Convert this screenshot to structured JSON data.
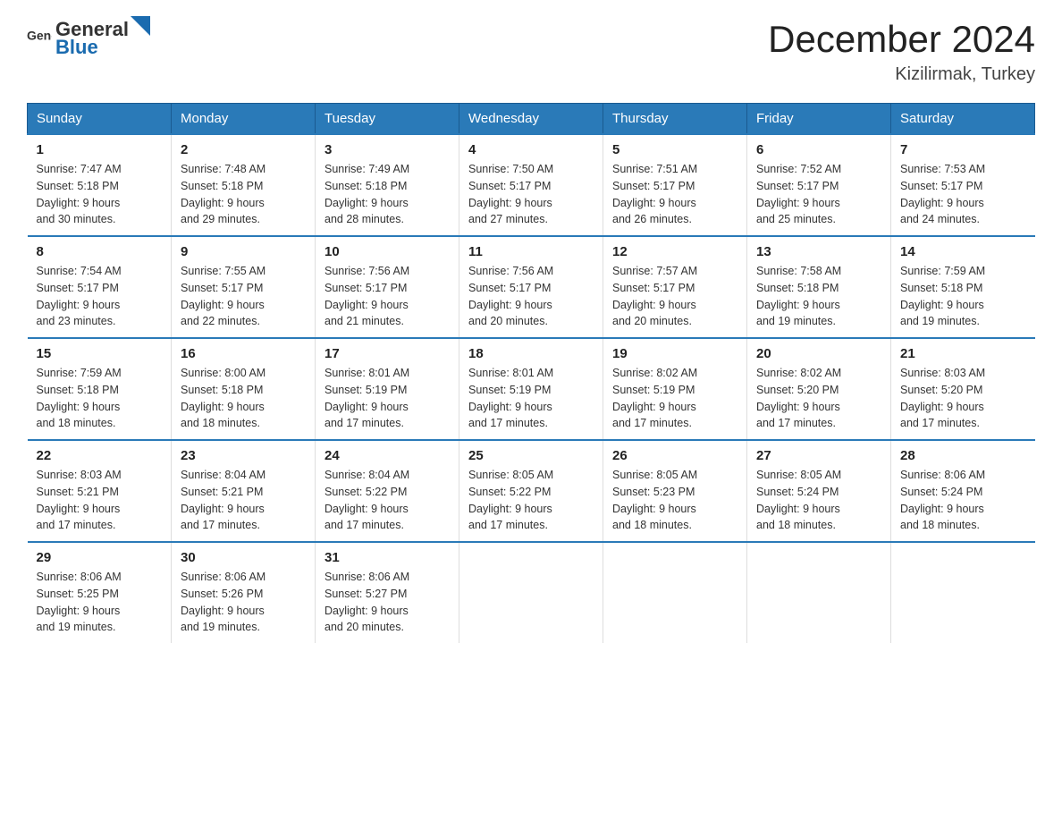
{
  "header": {
    "logo_general": "General",
    "logo_blue": "Blue",
    "month_title": "December 2024",
    "location": "Kizilirmak, Turkey"
  },
  "days_of_week": [
    "Sunday",
    "Monday",
    "Tuesday",
    "Wednesday",
    "Thursday",
    "Friday",
    "Saturday"
  ],
  "weeks": [
    [
      {
        "day": "1",
        "info": "Sunrise: 7:47 AM\nSunset: 5:18 PM\nDaylight: 9 hours\nand 30 minutes."
      },
      {
        "day": "2",
        "info": "Sunrise: 7:48 AM\nSunset: 5:18 PM\nDaylight: 9 hours\nand 29 minutes."
      },
      {
        "day": "3",
        "info": "Sunrise: 7:49 AM\nSunset: 5:18 PM\nDaylight: 9 hours\nand 28 minutes."
      },
      {
        "day": "4",
        "info": "Sunrise: 7:50 AM\nSunset: 5:17 PM\nDaylight: 9 hours\nand 27 minutes."
      },
      {
        "day": "5",
        "info": "Sunrise: 7:51 AM\nSunset: 5:17 PM\nDaylight: 9 hours\nand 26 minutes."
      },
      {
        "day": "6",
        "info": "Sunrise: 7:52 AM\nSunset: 5:17 PM\nDaylight: 9 hours\nand 25 minutes."
      },
      {
        "day": "7",
        "info": "Sunrise: 7:53 AM\nSunset: 5:17 PM\nDaylight: 9 hours\nand 24 minutes."
      }
    ],
    [
      {
        "day": "8",
        "info": "Sunrise: 7:54 AM\nSunset: 5:17 PM\nDaylight: 9 hours\nand 23 minutes."
      },
      {
        "day": "9",
        "info": "Sunrise: 7:55 AM\nSunset: 5:17 PM\nDaylight: 9 hours\nand 22 minutes."
      },
      {
        "day": "10",
        "info": "Sunrise: 7:56 AM\nSunset: 5:17 PM\nDaylight: 9 hours\nand 21 minutes."
      },
      {
        "day": "11",
        "info": "Sunrise: 7:56 AM\nSunset: 5:17 PM\nDaylight: 9 hours\nand 20 minutes."
      },
      {
        "day": "12",
        "info": "Sunrise: 7:57 AM\nSunset: 5:17 PM\nDaylight: 9 hours\nand 20 minutes."
      },
      {
        "day": "13",
        "info": "Sunrise: 7:58 AM\nSunset: 5:18 PM\nDaylight: 9 hours\nand 19 minutes."
      },
      {
        "day": "14",
        "info": "Sunrise: 7:59 AM\nSunset: 5:18 PM\nDaylight: 9 hours\nand 19 minutes."
      }
    ],
    [
      {
        "day": "15",
        "info": "Sunrise: 7:59 AM\nSunset: 5:18 PM\nDaylight: 9 hours\nand 18 minutes."
      },
      {
        "day": "16",
        "info": "Sunrise: 8:00 AM\nSunset: 5:18 PM\nDaylight: 9 hours\nand 18 minutes."
      },
      {
        "day": "17",
        "info": "Sunrise: 8:01 AM\nSunset: 5:19 PM\nDaylight: 9 hours\nand 17 minutes."
      },
      {
        "day": "18",
        "info": "Sunrise: 8:01 AM\nSunset: 5:19 PM\nDaylight: 9 hours\nand 17 minutes."
      },
      {
        "day": "19",
        "info": "Sunrise: 8:02 AM\nSunset: 5:19 PM\nDaylight: 9 hours\nand 17 minutes."
      },
      {
        "day": "20",
        "info": "Sunrise: 8:02 AM\nSunset: 5:20 PM\nDaylight: 9 hours\nand 17 minutes."
      },
      {
        "day": "21",
        "info": "Sunrise: 8:03 AM\nSunset: 5:20 PM\nDaylight: 9 hours\nand 17 minutes."
      }
    ],
    [
      {
        "day": "22",
        "info": "Sunrise: 8:03 AM\nSunset: 5:21 PM\nDaylight: 9 hours\nand 17 minutes."
      },
      {
        "day": "23",
        "info": "Sunrise: 8:04 AM\nSunset: 5:21 PM\nDaylight: 9 hours\nand 17 minutes."
      },
      {
        "day": "24",
        "info": "Sunrise: 8:04 AM\nSunset: 5:22 PM\nDaylight: 9 hours\nand 17 minutes."
      },
      {
        "day": "25",
        "info": "Sunrise: 8:05 AM\nSunset: 5:22 PM\nDaylight: 9 hours\nand 17 minutes."
      },
      {
        "day": "26",
        "info": "Sunrise: 8:05 AM\nSunset: 5:23 PM\nDaylight: 9 hours\nand 18 minutes."
      },
      {
        "day": "27",
        "info": "Sunrise: 8:05 AM\nSunset: 5:24 PM\nDaylight: 9 hours\nand 18 minutes."
      },
      {
        "day": "28",
        "info": "Sunrise: 8:06 AM\nSunset: 5:24 PM\nDaylight: 9 hours\nand 18 minutes."
      }
    ],
    [
      {
        "day": "29",
        "info": "Sunrise: 8:06 AM\nSunset: 5:25 PM\nDaylight: 9 hours\nand 19 minutes."
      },
      {
        "day": "30",
        "info": "Sunrise: 8:06 AM\nSunset: 5:26 PM\nDaylight: 9 hours\nand 19 minutes."
      },
      {
        "day": "31",
        "info": "Sunrise: 8:06 AM\nSunset: 5:27 PM\nDaylight: 9 hours\nand 20 minutes."
      },
      {
        "day": "",
        "info": ""
      },
      {
        "day": "",
        "info": ""
      },
      {
        "day": "",
        "info": ""
      },
      {
        "day": "",
        "info": ""
      }
    ]
  ]
}
